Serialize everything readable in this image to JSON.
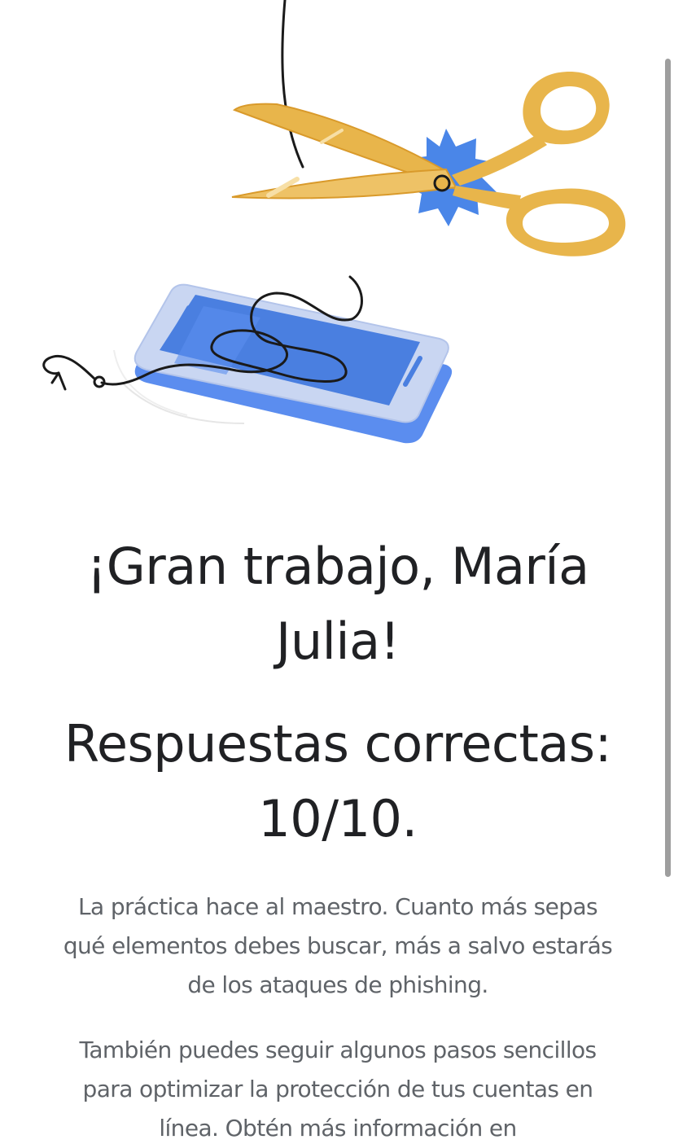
{
  "result": {
    "greeting": "¡Gran trabajo, María Julia!",
    "score": "Respuestas correctas: 10/10.",
    "paragraph_1": "La práctica hace al maestro. Cuanto más sepas qué elementos debes buscar, más a salvo estarás de los ataques de phishing.",
    "paragraph_2": "También puedes seguir algunos pasos sencillos para optimizar la protección de tus cuentas en línea. Obtén más información en"
  },
  "illustration": {
    "icons": [
      "scissors-icon",
      "phone-icon",
      "fishing-hook-icon"
    ],
    "colors": {
      "scissors_gold": "#E8B54B",
      "scissors_gold_dark": "#D99A2B",
      "starburst_blue": "#4A86E8",
      "phone_blue": "#4A7FE0",
      "phone_frame": "#C9D6F2",
      "line_black": "#1a1a1a"
    }
  }
}
